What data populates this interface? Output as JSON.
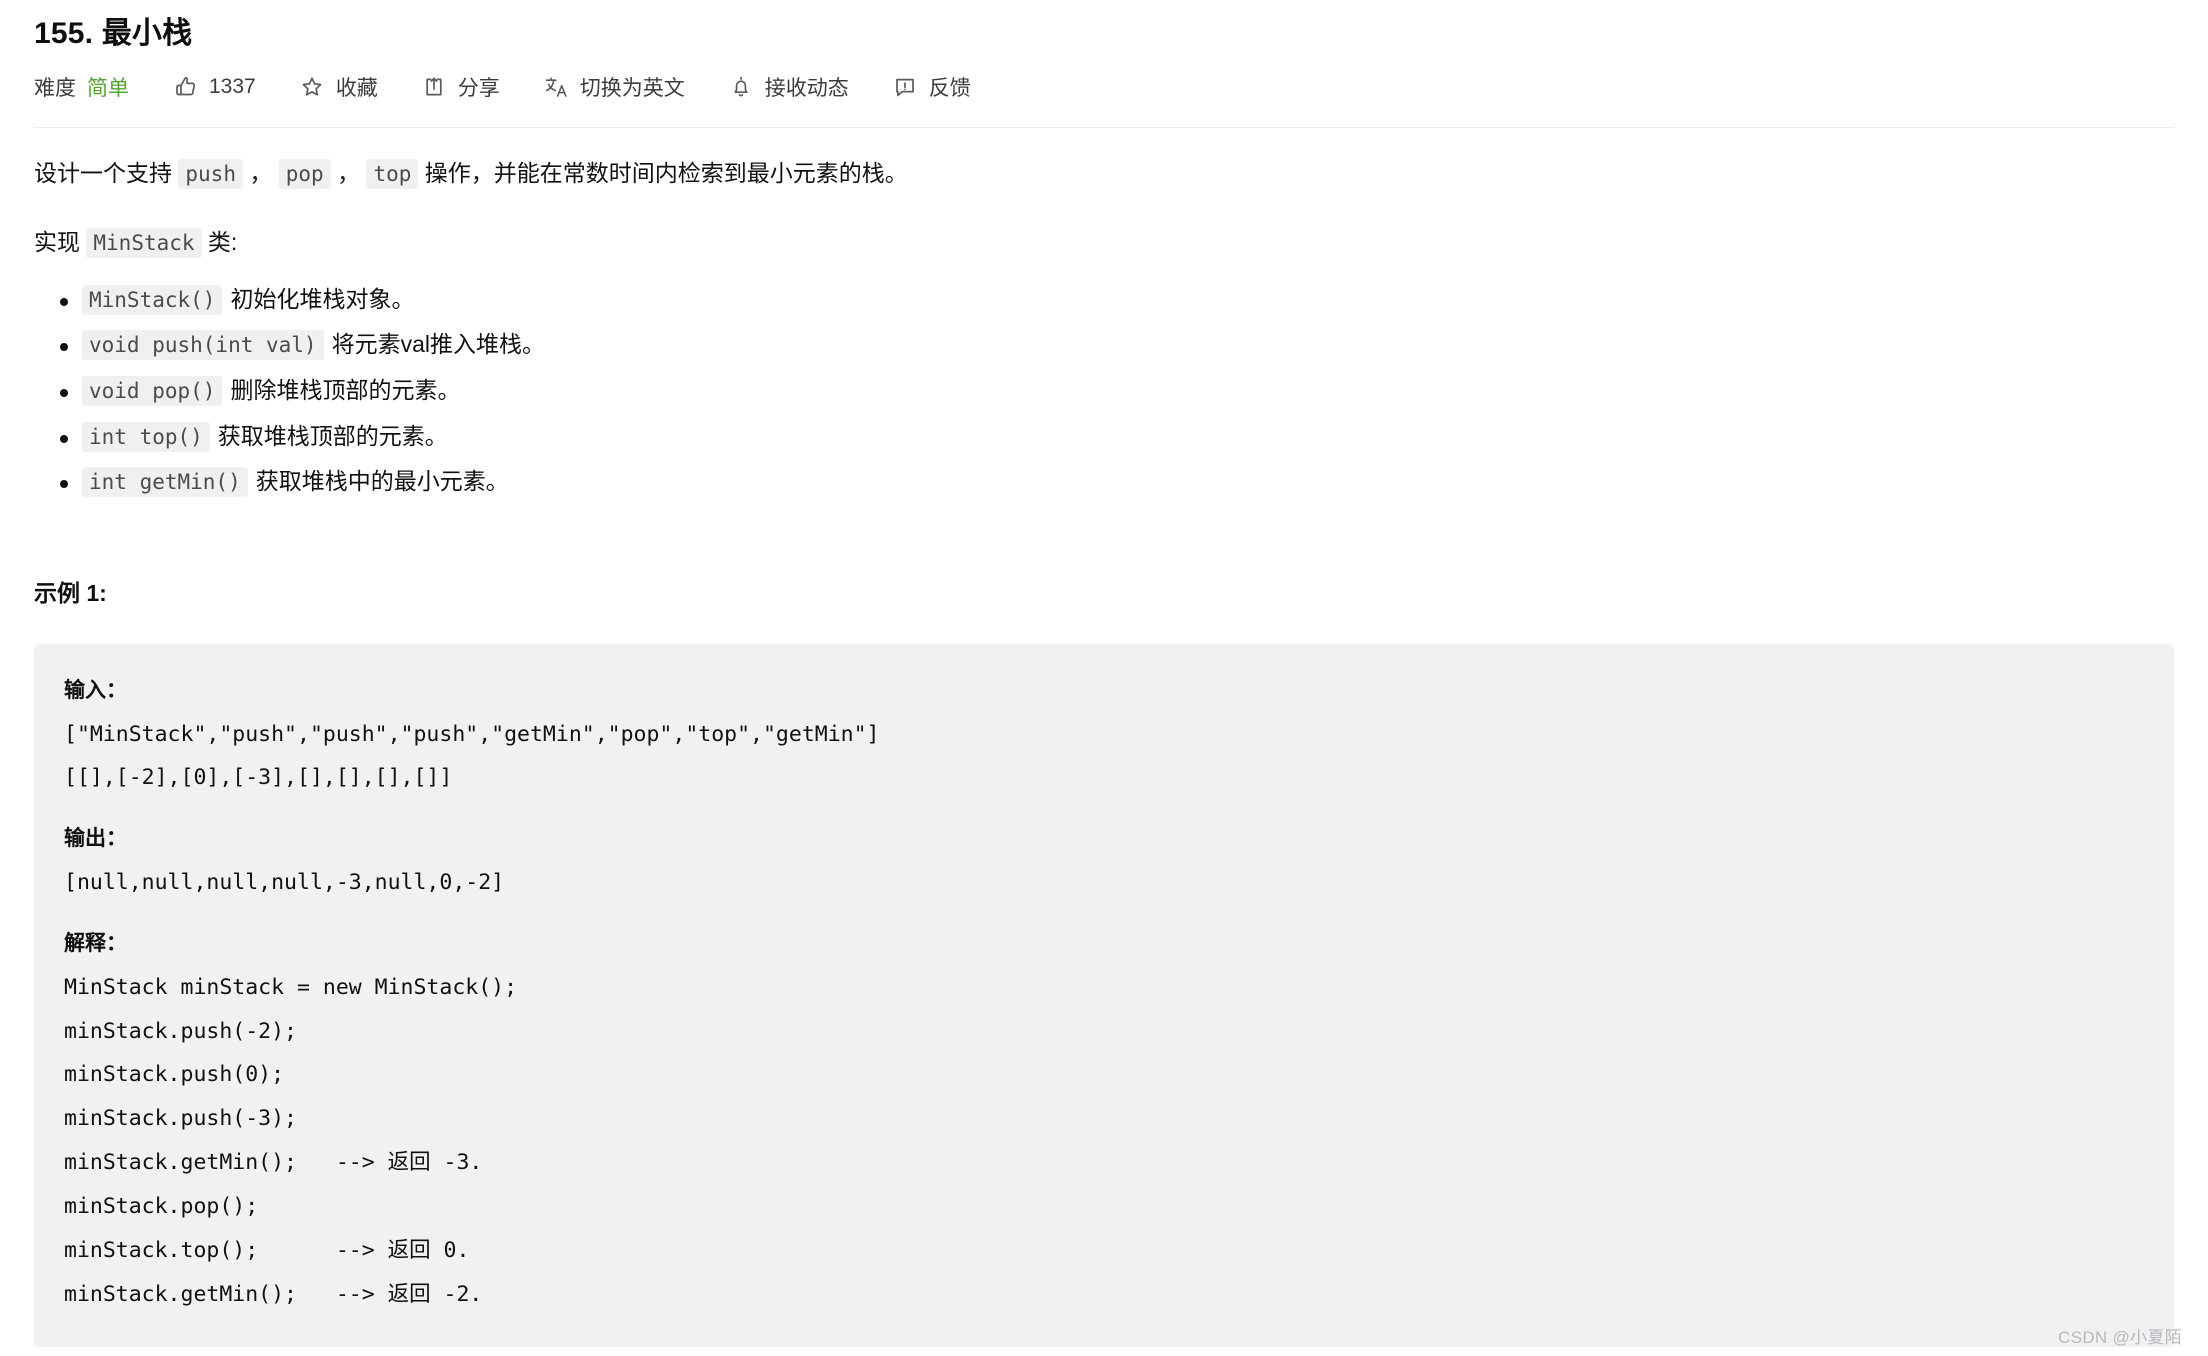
{
  "problem": {
    "title": "155. 最小栈",
    "difficulty_label": "难度",
    "difficulty_value": "简单",
    "difficulty_color": "#55a532"
  },
  "toolbar": {
    "likes": {
      "icon": "thumbs-up-icon",
      "count": "1337"
    },
    "favorite": {
      "icon": "star-icon",
      "label": "收藏"
    },
    "share": {
      "icon": "share-icon",
      "label": "分享"
    },
    "translate": {
      "icon": "translate-icon",
      "label": "切换为英文"
    },
    "subscribe": {
      "icon": "bell-icon",
      "label": "接收动态"
    },
    "feedback": {
      "icon": "feedback-icon",
      "label": "反馈"
    }
  },
  "description": {
    "line1": {
      "prefix": "设计一个支持 ",
      "code1": "push",
      "sep1": " ， ",
      "code2": "pop",
      "sep2": " ， ",
      "code3": "top",
      "suffix": " 操作，并能在常数时间内检索到最小元素的栈。"
    },
    "line2": {
      "prefix": "实现 ",
      "code": "MinStack",
      "suffix": " 类:"
    }
  },
  "api_items": [
    {
      "code": "MinStack()",
      "text": "初始化堆栈对象。"
    },
    {
      "code": "void push(int val)",
      "text": "将元素val推入堆栈。"
    },
    {
      "code": "void pop()",
      "text": "删除堆栈顶部的元素。"
    },
    {
      "code": "int top()",
      "text": "获取堆栈顶部的元素。"
    },
    {
      "code": "int getMin()",
      "text": "获取堆栈中的最小元素。"
    }
  ],
  "example": {
    "heading": "示例 1:",
    "input_label": "输入：",
    "input_lines": [
      "[\"MinStack\",\"push\",\"push\",\"push\",\"getMin\",\"pop\",\"top\",\"getMin\"]",
      "[[],[-2],[0],[-3],[],[],[],[]]"
    ],
    "output_label": "输出：",
    "output_lines": [
      "[null,null,null,null,-3,null,0,-2]"
    ],
    "explain_label": "解释：",
    "explain_lines": [
      "MinStack minStack = new MinStack();",
      "minStack.push(-2);",
      "minStack.push(0);",
      "minStack.push(-3);",
      "minStack.getMin();   --> 返回 -3.",
      "minStack.pop();",
      "minStack.top();      --> 返回 0.",
      "minStack.getMin();   --> 返回 -2."
    ]
  },
  "watermark": "CSDN @小夏陌"
}
